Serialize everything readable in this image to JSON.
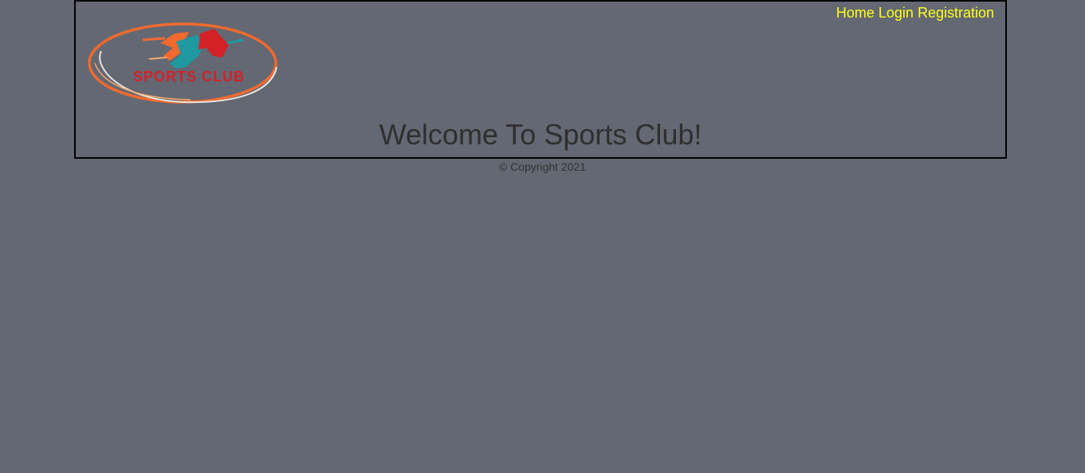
{
  "nav": {
    "home_label": "Home",
    "login_label": "Login",
    "registration_label": "Registration"
  },
  "logo": {
    "text": "SPORTS CLUB",
    "icon": "sports-club-logo"
  },
  "main": {
    "welcome_heading": "Welcome To Sports Club!"
  },
  "footer": {
    "copyright": "© Copyright 2021"
  },
  "colors": {
    "background": "#636873",
    "nav_link": "#ffff1a",
    "heading_text": "#2f2f2f",
    "logo_orange": "#f26a2e",
    "logo_teal": "#1f98a0",
    "logo_red": "#d42027"
  }
}
